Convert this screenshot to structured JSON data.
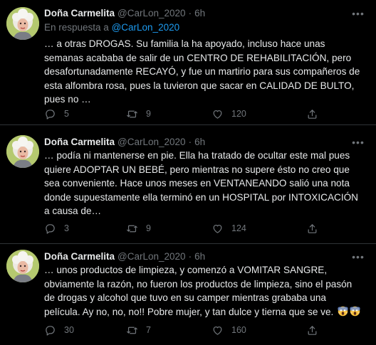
{
  "tweets": [
    {
      "author": "Doña Carmelita",
      "handle": "@CarLon_2020",
      "time": "6h",
      "reply_prefix": "En respuesta a",
      "reply_handle": "@CarLon_2020",
      "text": "… a otras DROGAS. Su familia la ha apoyado, incluso hace unas semanas acababa de salir de un CENTRO DE REHABILITACIÓN, pero desafortunadamente RECAYÓ, y fue un martirio para sus compañeros de esta alfombra rosa, pues la tuvieron que sacar en CALIDAD DE BULTO, pues no …",
      "replies": "5",
      "retweets": "9",
      "likes": "120"
    },
    {
      "author": "Doña Carmelita",
      "handle": "@CarLon_2020",
      "time": "6h",
      "text": "… podía ni mantenerse en pie. Ella ha tratado de ocultar este mal pues quiere ADOPTAR UN BEBÉ, pero mientras no supere ésto no creo que sea conveniente. Hace unos meses en VENTANEANDO salió una nota donde supuestamente ella terminó en un HOSPITAL por INTOXICACIÓN a causa de…",
      "replies": "3",
      "retweets": "9",
      "likes": "124"
    },
    {
      "author": "Doña Carmelita",
      "handle": "@CarLon_2020",
      "time": "6h",
      "text": "… unos productos de limpieza, y comenzó a VOMITAR SANGRE, obviamente la razón, no fueron los productos de limpieza, sino el pasón de drogas y alcohol que tuvo en su camper mientras grababa una película. Ay no, no, no!! Pobre mujer, y tan dulce y tierna que se ve.",
      "emoji": "screaming-face-icon",
      "replies": "30",
      "retweets": "7",
      "likes": "160"
    }
  ],
  "separator": "·",
  "colors": {
    "background": "#000000",
    "text": "#e7e9ea",
    "secondary": "#71767b",
    "link": "#1d9bf0",
    "divider": "#2f3336"
  }
}
